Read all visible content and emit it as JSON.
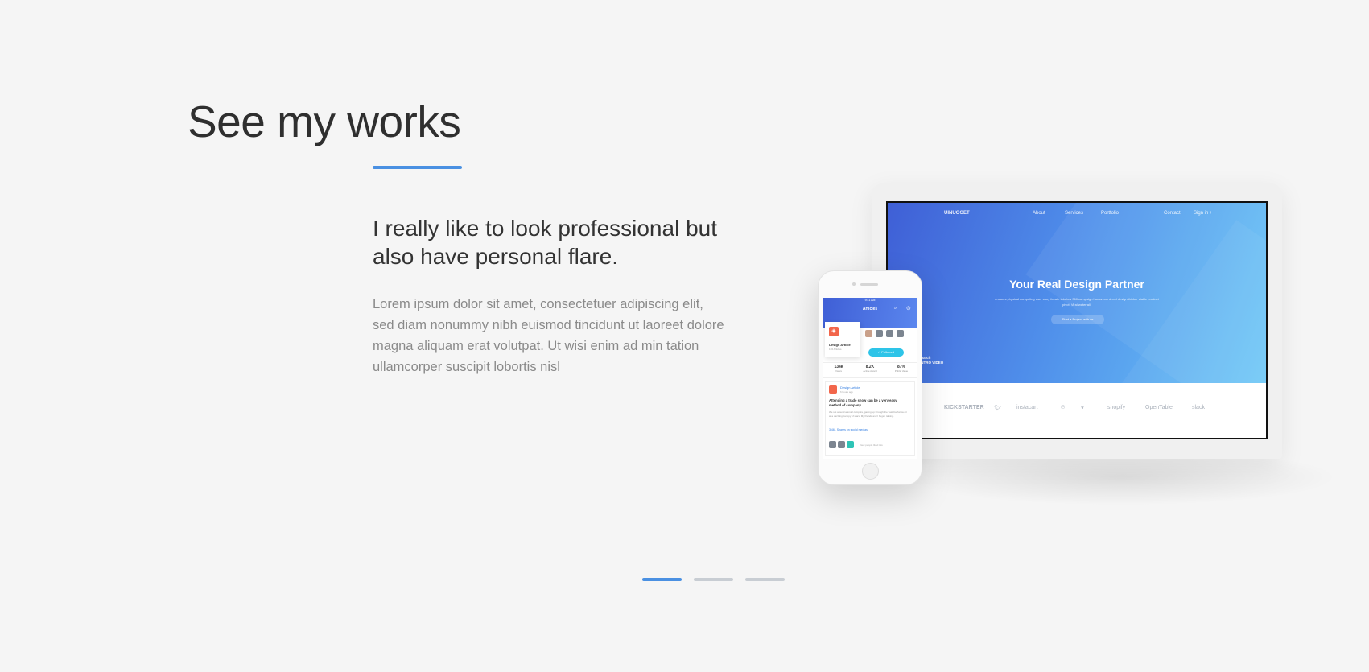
{
  "section": {
    "title": "See my works",
    "subtitle": "I really like to look professional but also have personal flare.",
    "body": "Lorem ipsum dolor sit amet, consectetuer adipiscing elit, sed diam nonummy nibh euismod tincidunt ut laoreet dolore magna aliquam erat volutpat. Ut wisi enim ad min tation ullamcorper suscipit lobortis nisl",
    "accent_color": "#4a90e2"
  },
  "laptop_site": {
    "logo": "UINUGGET",
    "nav": [
      "About",
      "Services",
      "Portfolio",
      "Contact",
      "Sign in +"
    ],
    "hero_title": "Your Real Design Partner",
    "hero_sub": "ensures physical computing user story iterate inbelow 360 campaign human-centered design thinker viable product pivot. Viral waterfall.",
    "hero_button": "Start a Project with us",
    "intro_label_1": "Watch",
    "intro_label_2": "INTRO VIDEO",
    "logos": [
      "KICKSTARTER",
      "twitter",
      "instacart",
      "pinterest",
      "vimeo",
      "shopify",
      "OpenTable",
      "slack"
    ]
  },
  "phone_app": {
    "status_time": "9:41 AM",
    "header_title": "Articles",
    "card_title": "Design Article",
    "card_sub": "136 Articles",
    "followed_label": "✓ Followed",
    "stats": [
      {
        "value": "134k",
        "label": "Views"
      },
      {
        "value": "8.2K",
        "label": "Active Award"
      },
      {
        "value": "87%",
        "label": "Public Value"
      }
    ],
    "post_category": "Design Article",
    "post_time": "6 hours ago",
    "post_title": "Attending a trade show can be a very easy method of company.",
    "post_body": "We sat around a small campfire, gazing up through the vast California air at a dazzling canopy of stars. My friends and I began talking.",
    "post_share": "3,461 Shares on social medias",
    "post_foot": "View people liked this"
  },
  "pager": {
    "pages": [
      "1",
      "2",
      "3"
    ],
    "active_index": 0
  }
}
